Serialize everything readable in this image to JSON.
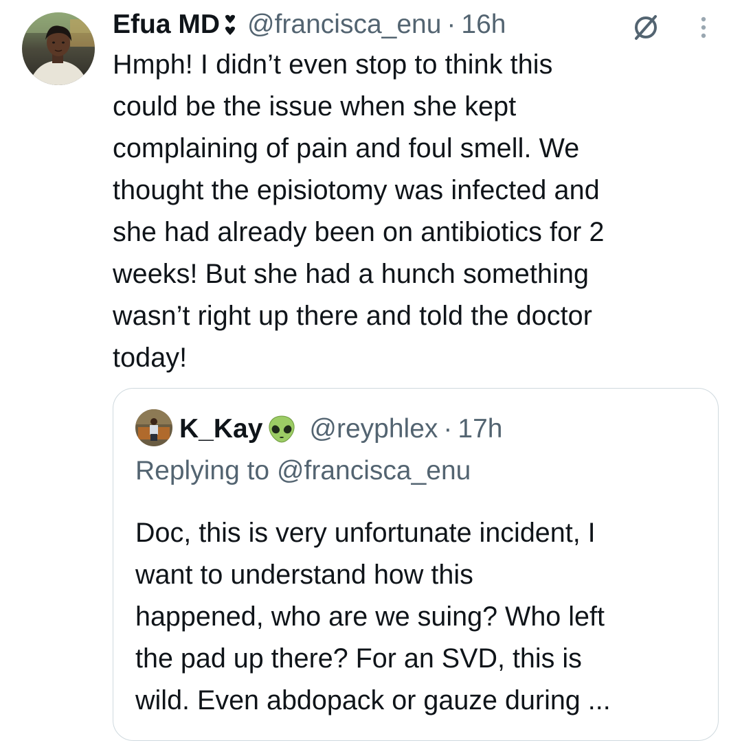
{
  "tweet": {
    "author": {
      "display_name": "Efua MD",
      "badge_emoji": "heart-exclamation",
      "handle": "@francisca_enu",
      "separator": "·",
      "time": "16h",
      "avatar_icon": "profile-photo"
    },
    "text_lines": [
      "Hmph! I didn’t even stop to think this",
      "could be the issue when she kept",
      "complaining of pain and foul smell. We",
      "thought the episiotomy was infected and",
      "she had already been on antibiotics for 2",
      "weeks! But she had a hunch something",
      "wasn’t right up there and told the doctor",
      "today!"
    ],
    "icons": {
      "status_icon": "no-sign-icon",
      "menu_icon": "more-vertical-icon"
    }
  },
  "quoted_tweet": {
    "author": {
      "display_name": "K_Kay",
      "emoji": "alien",
      "handle": "@reyphlex",
      "separator": "·",
      "time": "17h",
      "avatar_icon": "profile-photo"
    },
    "replying_to": "Replying to @francisca_enu",
    "text_lines": [
      "Doc, this is very unfortunate incident, I",
      "want to understand how this",
      "happened, who are we suing? Who left",
      "the pad up there? For an SVD, this is",
      "wild. Even abdopack or gauze during ..."
    ]
  },
  "colors": {
    "primary_text": "#0f1419",
    "secondary_text": "#536471",
    "border": "#cfd9de",
    "background": "#ffffff"
  }
}
